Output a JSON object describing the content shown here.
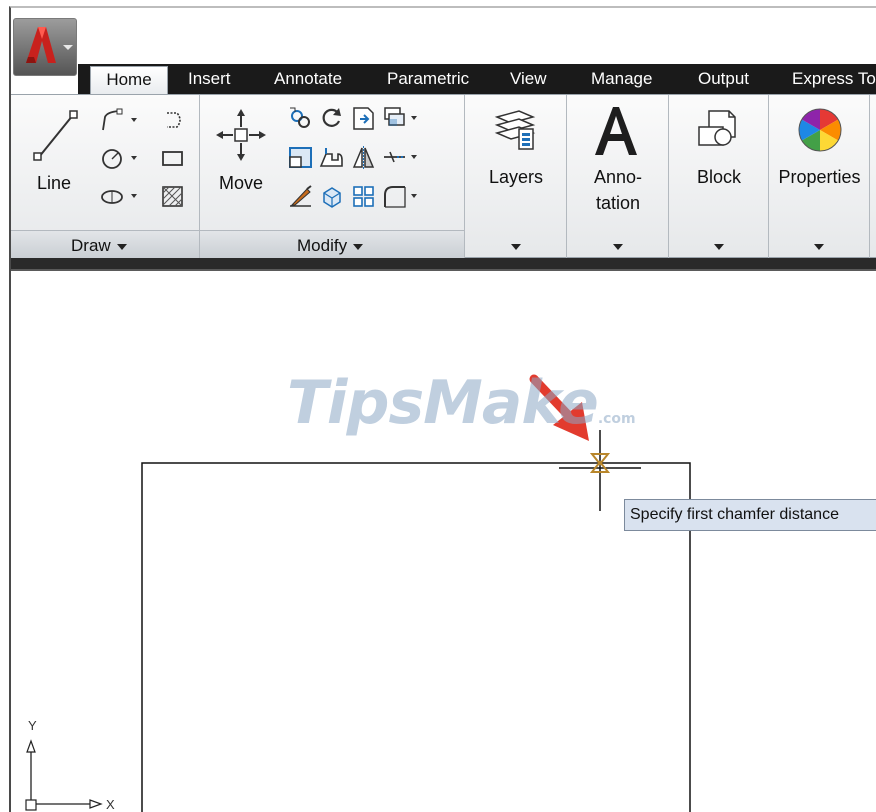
{
  "ribbon": {
    "tabs": [
      {
        "label": "Home",
        "active": true
      },
      {
        "label": "Insert"
      },
      {
        "label": "Annotate"
      },
      {
        "label": "Parametric"
      },
      {
        "label": "View"
      },
      {
        "label": "Manage"
      },
      {
        "label": "Output"
      },
      {
        "label": "Express To"
      }
    ],
    "draw_panel": {
      "title": "Draw",
      "line_label": "Line",
      "tools": [
        "polyline-icon",
        "arc-icon",
        "circle-icon",
        "rectangle-icon",
        "ellipse-icon",
        "hatch-icon"
      ]
    },
    "modify_panel": {
      "title": "Modify",
      "move_label": "Move",
      "tools": [
        "copy-icon",
        "rotate-icon",
        "trim-icon",
        "array-icon",
        "stretch-icon",
        "mirror-icon",
        "fillet-icon",
        "match-properties-icon",
        "explode-icon",
        "offset-icon",
        "chamfer-icon",
        "erase-icon"
      ]
    },
    "layers_label": "Layers",
    "annotation_label_line1": "Anno-",
    "annotation_label_line2": "tation",
    "block_label": "Block",
    "properties_label": "Properties"
  },
  "canvas": {
    "prompt_tooltip": "Specify first chamfer distance",
    "watermark": "TipsMake",
    "watermark_suffix": ".com",
    "ucs": {
      "x_label": "X",
      "y_label": "Y"
    }
  },
  "colors": {
    "tab_bar": "#1a1a1a",
    "app_logo_red": "#c8211d",
    "tooltip_bg": "#d9e2ef",
    "pointer_arrow": "#e23b2e",
    "watermark": "#8ca8c4"
  }
}
